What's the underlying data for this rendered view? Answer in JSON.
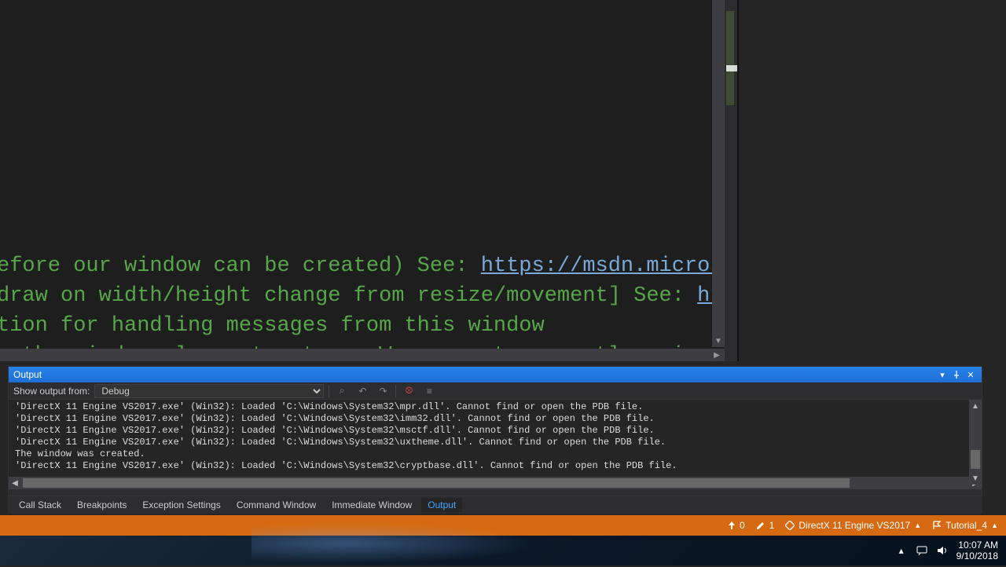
{
  "editor": {
    "code_lines": [
      "efore our window can be created) See: ",
      "draw on width/height change from resize/movement] See: ",
      "tion for handling messages from this window",
      "g the window-class structure. We are not currently using",
      ""
    ],
    "link1": "https://msdn.micros",
    "link2": "ht"
  },
  "output": {
    "title": "Output",
    "label": "Show output from:",
    "source": "Debug",
    "lines": [
      "'DirectX 11 Engine VS2017.exe' (Win32): Loaded 'C:\\Windows\\System32\\mpr.dll'. Cannot find or open the PDB file.",
      "'DirectX 11 Engine VS2017.exe' (Win32): Loaded 'C:\\Windows\\System32\\imm32.dll'. Cannot find or open the PDB file.",
      "'DirectX 11 Engine VS2017.exe' (Win32): Loaded 'C:\\Windows\\System32\\msctf.dll'. Cannot find or open the PDB file.",
      "'DirectX 11 Engine VS2017.exe' (Win32): Loaded 'C:\\Windows\\System32\\uxtheme.dll'. Cannot find or open the PDB file.",
      "The window was created.",
      "'DirectX 11 Engine VS2017.exe' (Win32): Loaded 'C:\\Windows\\System32\\cryptbase.dll'. Cannot find or open the PDB file."
    ]
  },
  "tabs": {
    "items": [
      "Call Stack",
      "Breakpoints",
      "Exception Settings",
      "Command Window",
      "Immediate Window",
      "Output"
    ],
    "active": "Output"
  },
  "status": {
    "up_count": "0",
    "down_count": "1",
    "project": "DirectX 11 Engine VS2017",
    "solution": "Tutorial_4"
  },
  "tray": {
    "time": "10:07 AM",
    "date": "9/10/2018"
  }
}
